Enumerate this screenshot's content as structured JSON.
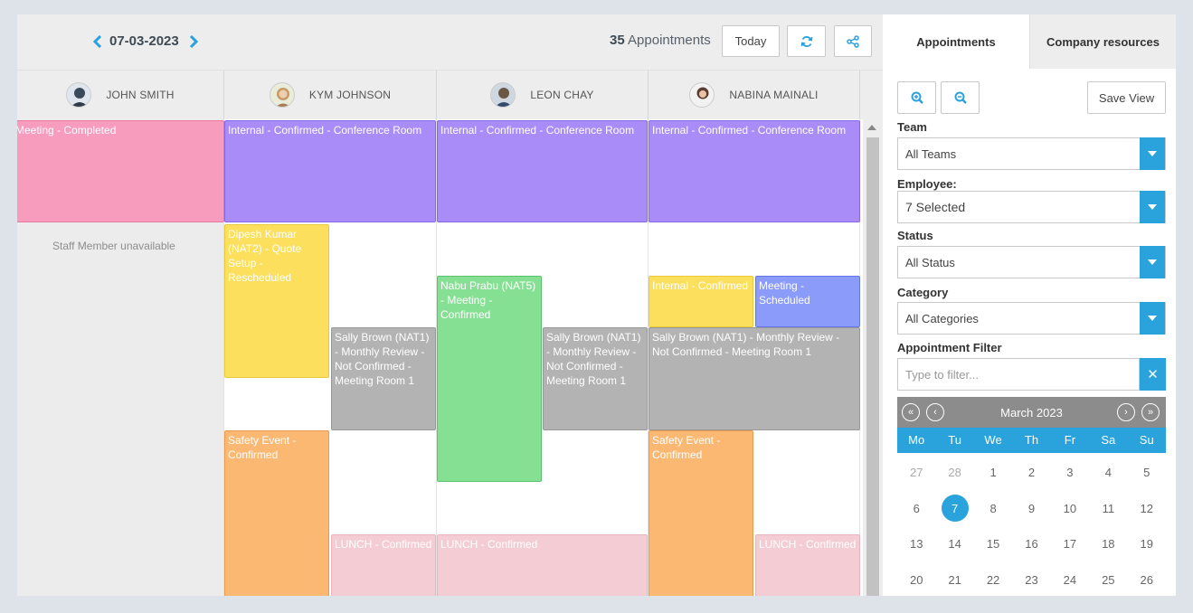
{
  "toolbar": {
    "date": "07-03-2023",
    "appointment_count": "35",
    "appointment_count_label": "Appointments",
    "today_label": "Today"
  },
  "employees": [
    {
      "name": "JOHN SMITH",
      "avatar_color": "#3b4a5a"
    },
    {
      "name": "KYM JOHNSON",
      "avatar_color": "#c79b6a"
    },
    {
      "name": "LEON CHAY",
      "avatar_color": "#6b5844"
    },
    {
      "name": "NABINA MAINALI",
      "avatar_color": "#5a3d30"
    }
  ],
  "grid": {
    "unavailable_text": "Staff Member unavailable",
    "events": [
      {
        "text": "Meeting - Completed"
      },
      {
        "text": "Internal - Confirmed - Conference Room"
      },
      {
        "text": "Internal - Confirmed - Conference Room"
      },
      {
        "text": "Internal - Confirmed - Conference Room"
      },
      {
        "text": "Dipesh Kumar (NAT2) - Quote Setup - Rescheduled"
      },
      {
        "text": "Sally Brown (NAT1) - Monthly Review - Not Confirmed - Meeting Room 1"
      },
      {
        "text": "Nabu Prabu (NAT5) - Meeting - Confirmed"
      },
      {
        "text": "Sally Brown (NAT1) - Monthly Review - Not Confirmed - Meeting Room 1"
      },
      {
        "text": "Internal - Confirmed"
      },
      {
        "text": "Meeting - Scheduled"
      },
      {
        "text": "Sally Brown (NAT1) - Monthly Review - Not Confirmed - Meeting Room 1"
      },
      {
        "text": "Safety Event - Confirmed"
      },
      {
        "text": "Safety Event - Confirmed"
      },
      {
        "text": "LUNCH - Confirmed"
      },
      {
        "text": "LUNCH - Confirmed"
      },
      {
        "text": "LUNCH - Confirmed"
      }
    ]
  },
  "panel": {
    "tabs": [
      "Appointments",
      "Company resources"
    ],
    "save_view_label": "Save View",
    "filters": {
      "team_label": "Team",
      "team_value": "All Teams",
      "employee_label": "Employee:",
      "employee_value": "7 Selected",
      "status_label": "Status",
      "status_value": "All Status",
      "category_label": "Category",
      "category_value": "All Categories",
      "appt_filter_label": "Appointment Filter",
      "appt_filter_placeholder": "Type to filter..."
    },
    "calendar": {
      "title": "March 2023",
      "weekdays": [
        "Mo",
        "Tu",
        "We",
        "Th",
        "Fr",
        "Sa",
        "Su"
      ],
      "weeks": [
        [
          "27",
          "28",
          "1",
          "2",
          "3",
          "4",
          "5"
        ],
        [
          "6",
          "7",
          "8",
          "9",
          "10",
          "11",
          "12"
        ],
        [
          "13",
          "14",
          "15",
          "16",
          "17",
          "18",
          "19"
        ],
        [
          "20",
          "21",
          "22",
          "23",
          "24",
          "25",
          "26"
        ]
      ],
      "selected": "7"
    }
  },
  "colors": {
    "accent": "#2aa2dc",
    "toolbar_bg": "#ededed"
  }
}
